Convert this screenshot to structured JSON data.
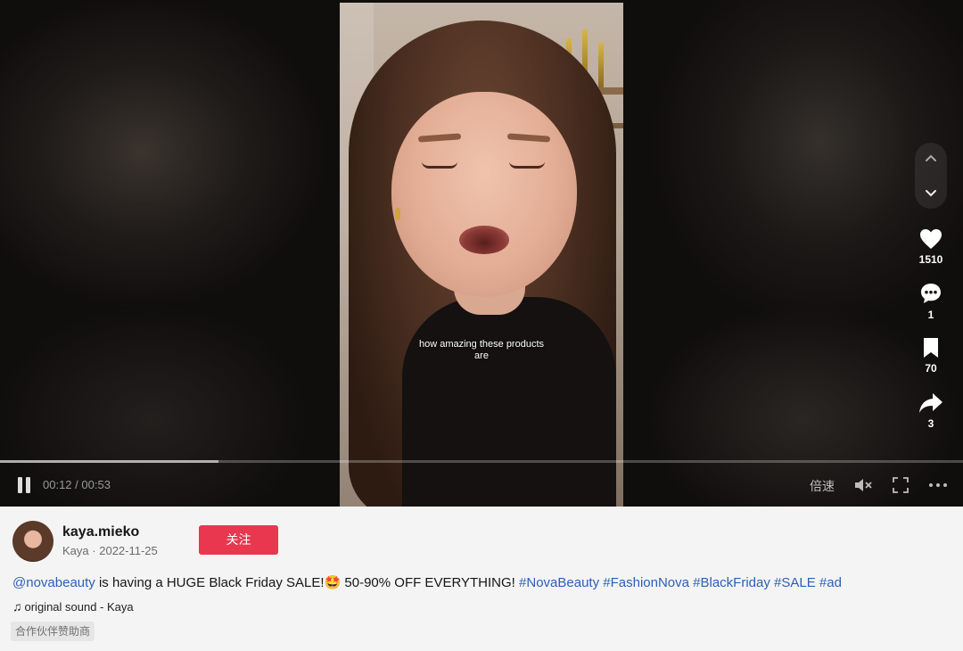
{
  "video": {
    "caption_line1": "how amazing these products",
    "caption_line2": "are",
    "progress_fraction": 0.2264
  },
  "player_controls": {
    "current_time": "00:12",
    "separator": "/",
    "duration": "00:53",
    "speed_label": "倍速"
  },
  "actions": {
    "likes": "1510",
    "comments": "1",
    "saves": "70",
    "shares": "3"
  },
  "author": {
    "username": "kaya.mieko",
    "display_name": "Kaya",
    "date_separator": "·",
    "date": "2022-11-25",
    "follow_label": "关注"
  },
  "description": {
    "mention": "@novabeauty",
    "text": " is having a HUGE Black Friday SALE!🤩 50-90% OFF EVERYTHING! ",
    "hashtags": [
      "#NovaBeauty",
      "#FashionNova",
      "#BlackFriday",
      "#SALE",
      "#ad"
    ]
  },
  "sound": {
    "label": "original sound - Kaya"
  },
  "sponsor_tag": "合作伙伴赞助商",
  "icons": {
    "nav_up": "chevron-up-icon",
    "nav_down": "chevron-down-icon",
    "like": "heart-icon",
    "comment": "comment-icon",
    "save": "bookmark-icon",
    "share": "share-icon",
    "pause": "pause-icon",
    "mute": "volume-muted-icon",
    "fullscreen": "fullscreen-icon",
    "more": "more-icon",
    "music": "music-note-icon"
  },
  "colors": {
    "follow_button": "#e8374f",
    "link": "#2b5fb8"
  }
}
